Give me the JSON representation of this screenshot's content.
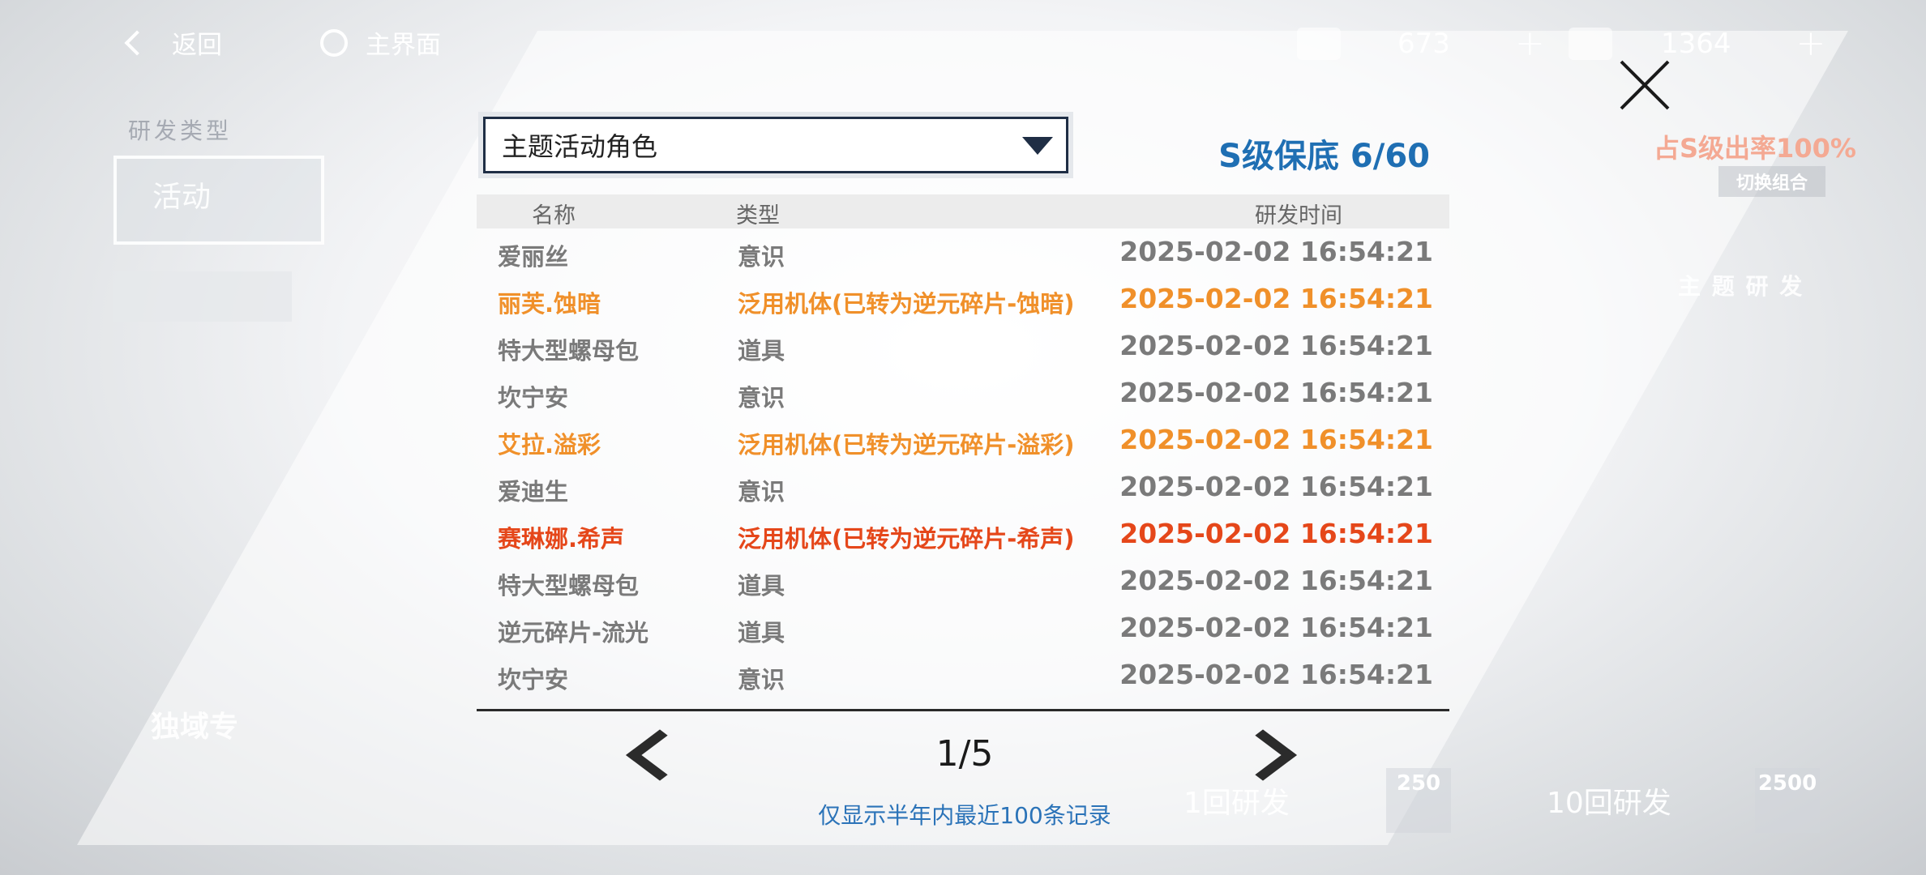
{
  "topbar": {
    "back_label": "返回",
    "home_label": "主界面",
    "resource1": "673",
    "resource2": "1364",
    "plus": "+"
  },
  "background": {
    "research_type_label": "研发类型",
    "activity_label": "活动",
    "rate_text": "占S级出率100%",
    "switch_label": "切换组合",
    "theme_research": "主 题 研 发",
    "exclusive_label": "独域专",
    "one_pull": "1回研发",
    "ten_pull": "10回研发",
    "cost_one": "250",
    "cost_ten": "2500"
  },
  "modal": {
    "dropdown_value": "主题活动角色",
    "guarantee": "S级保底 6/60",
    "columns": {
      "name": "名称",
      "type": "类型",
      "time": "研发时间"
    },
    "rows": [
      {
        "name": "爱丽丝",
        "type": "意识",
        "time": "2025-02-02 16:54:21",
        "rarity": "normal"
      },
      {
        "name": "丽芙.蚀暗",
        "type": "泛用机体(已转为逆元碎片-蚀暗)",
        "time": "2025-02-02 16:54:21",
        "rarity": "orange"
      },
      {
        "name": "特大型螺母包",
        "type": "道具",
        "time": "2025-02-02 16:54:21",
        "rarity": "normal"
      },
      {
        "name": "坎宁安",
        "type": "意识",
        "time": "2025-02-02 16:54:21",
        "rarity": "normal"
      },
      {
        "name": "艾拉.溢彩",
        "type": "泛用机体(已转为逆元碎片-溢彩)",
        "time": "2025-02-02 16:54:21",
        "rarity": "orange"
      },
      {
        "name": "爱迪生",
        "type": "意识",
        "time": "2025-02-02 16:54:21",
        "rarity": "normal"
      },
      {
        "name": "赛琳娜.希声",
        "type": "泛用机体(已转为逆元碎片-希声)",
        "time": "2025-02-02 16:54:21",
        "rarity": "red"
      },
      {
        "name": "特大型螺母包",
        "type": "道具",
        "time": "2025-02-02 16:54:21",
        "rarity": "normal"
      },
      {
        "name": "逆元碎片-流光",
        "type": "道具",
        "time": "2025-02-02 16:54:21",
        "rarity": "normal"
      },
      {
        "name": "坎宁安",
        "type": "意识",
        "time": "2025-02-02 16:54:21",
        "rarity": "normal"
      }
    ],
    "page": "1/5",
    "note": "仅显示半年内最近100条记录"
  },
  "colors": {
    "accent_blue": "#1f6fb3",
    "orange": "#f0902a",
    "red": "#e5471a"
  }
}
